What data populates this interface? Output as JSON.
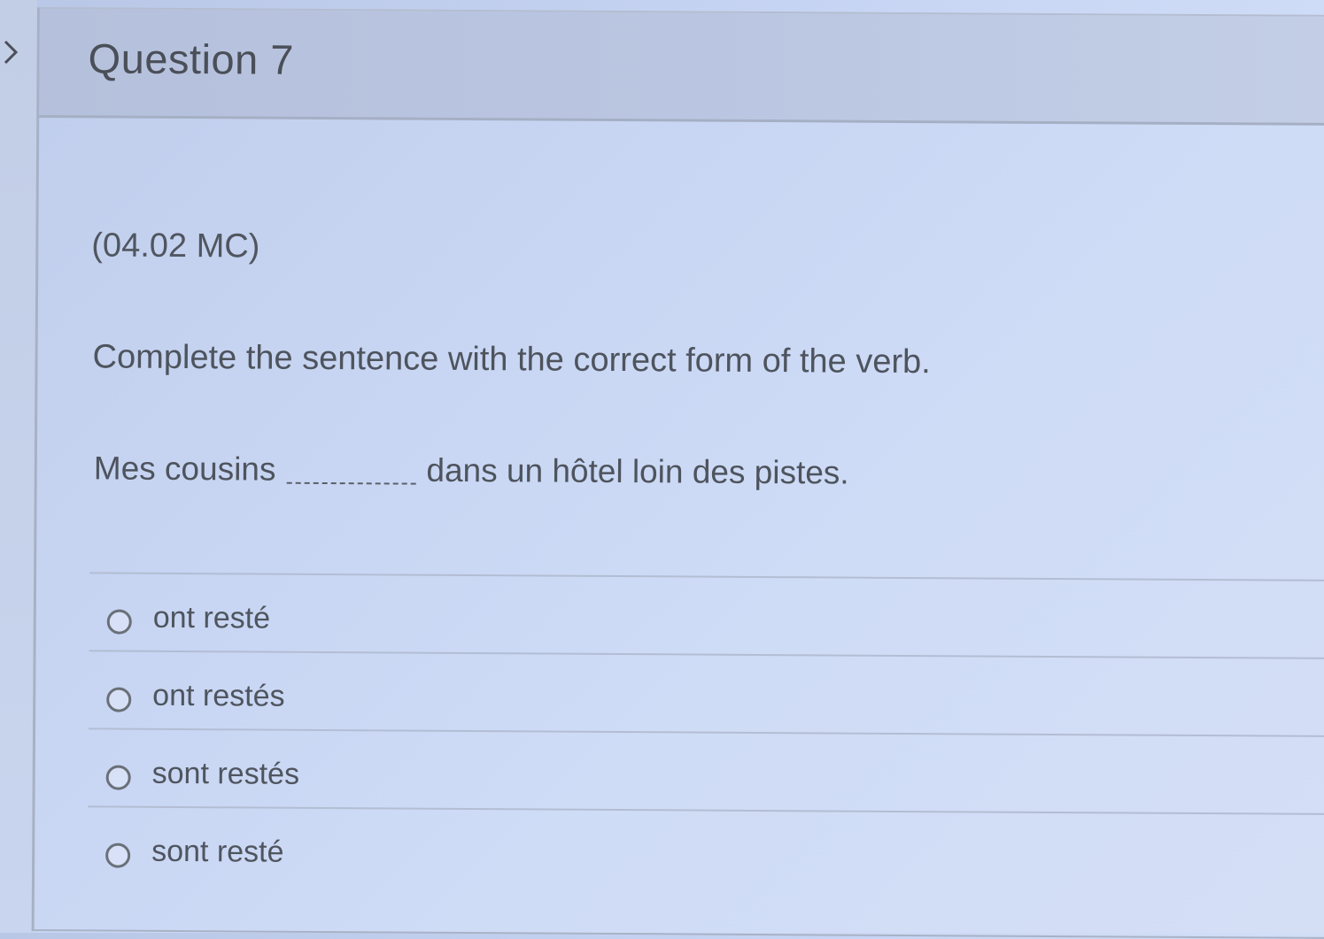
{
  "question": {
    "title": "Question 7",
    "code": "(04.02 MC)",
    "instruction": "Complete the sentence with the correct form of the verb.",
    "prompt_before": "Mes cousins",
    "prompt_after": "dans un hôtel loin des pistes."
  },
  "options": [
    {
      "label": "ont resté"
    },
    {
      "label": "ont restés"
    },
    {
      "label": "sont restés"
    },
    {
      "label": "sont resté"
    }
  ],
  "icons": {
    "expand": "chevron-right-icon",
    "option_radio": "radio-button-icon"
  },
  "colors": {
    "background": "#c6d4f3",
    "header": "#b8c4de",
    "text": "#4e545d"
  }
}
